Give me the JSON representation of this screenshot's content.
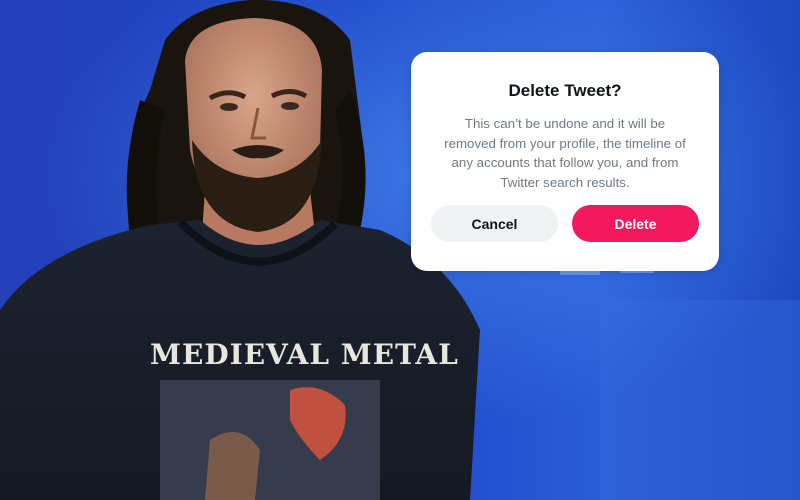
{
  "photo": {
    "shirt_text": "MEDIEVAL METAL"
  },
  "dialog": {
    "title": "Delete Tweet?",
    "body_lines": [
      "This can’t be undone and it will be",
      "removed from your profile, the timeline of",
      "any accounts that follow you, and from",
      "Twitter search results."
    ],
    "cancel_label": "Cancel",
    "delete_label": "Delete"
  },
  "colors": {
    "delete_button": "#f4185f",
    "cancel_button": "#eff3f4",
    "title_text": "#0f1419",
    "body_text": "#6e7a85",
    "background": "#1d3fb0"
  }
}
